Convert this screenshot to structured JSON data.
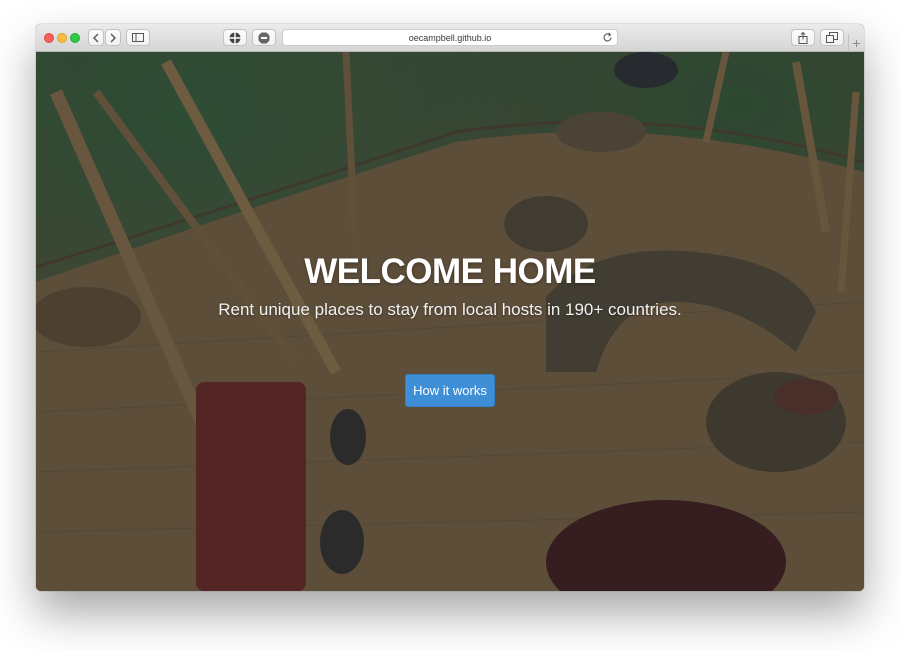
{
  "browser": {
    "url": "oecampbell.github.io",
    "new_tab_symbol": "+",
    "icons": [
      "close-light-icon",
      "minimize-light-icon",
      "zoom-light-icon",
      "chevron-left-icon",
      "chevron-right-icon",
      "sidebar-icon",
      "website-settings-icon",
      "adblock-icon",
      "reload-icon",
      "share-icon",
      "tabs-icon",
      "plus-icon"
    ]
  },
  "hero": {
    "title": "WELCOME HOME",
    "subtitle": "Rent unique places to stay from local hosts in 190+ countries.",
    "cta_label": "How it works"
  },
  "colors": {
    "cta": "#3e8fd6",
    "overlay": "#1e2a34"
  }
}
